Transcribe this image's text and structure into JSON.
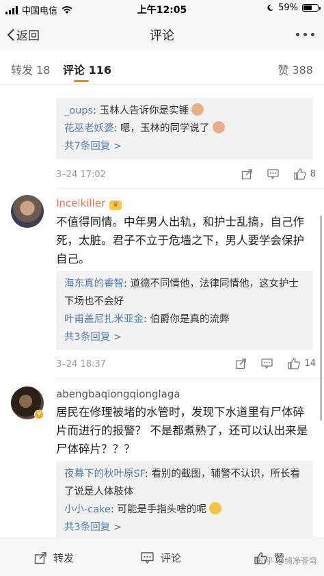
{
  "status_bar": {
    "carrier": "中国电信",
    "time": "上午12:05",
    "battery": "59%",
    "battery_level": 0.59
  },
  "nav": {
    "back_label": "返回",
    "title": "评论"
  },
  "tabs": {
    "repost": "转发 18",
    "comments": "评论 116",
    "likes": "赞 388"
  },
  "comments": [
    {
      "replies": [
        {
          "user": "_oups",
          "text": ": 玉林人告诉你是实锤",
          "emoji": "see-no-evil-monkey-icon"
        },
        {
          "user": "花巫老妖婆",
          "text": ": 嗯，玉林的同学说了",
          "emoji": "see-no-evil-monkey-icon"
        }
      ],
      "more_replies": "共7条回复 >",
      "date": "3–24 17:02",
      "likes": "8"
    },
    {
      "user": "Incelkiller",
      "text": "不值得同情。中年男人出轨，和护士乱搞，自己作死，太脏。君子不立于危墙之下，男人要学会保护自己。",
      "replies": [
        {
          "user": "海东真的睿智",
          "text": ": 道德不同情他，法律同情他，这女护士下场也不会好"
        },
        {
          "user": "叶甫盖尼扎米亚金",
          "text": ": 伯爵你是真的流弊"
        }
      ],
      "more_replies": "共3条回复 >",
      "date": "3–24 18:37",
      "likes": "14"
    },
    {
      "user": "abengbaqiongqionglaga",
      "text": "居民在修理被堵的水管时，发现下水道里有尸体碎片而进行的报警？ 不是都煮熟了，还可以认出来是尸体碎片？？？",
      "replies": [
        {
          "user": "夜幕下的秋叶原SF",
          "text": ": 看别的截图，辅警不认识，所长看了说是人体肢体"
        },
        {
          "user": "小小-cake",
          "text": ": 可能是手指头啥的呢",
          "emoji": "laughing-crying-icon"
        }
      ],
      "more_replies": "共3条回复 >"
    }
  ],
  "bottom_bar": {
    "repost": "转发",
    "comment": "评论",
    "like": "赞",
    "watermark": "知乎 @纯净苍穹"
  },
  "colors": {
    "accent": "#ff8200",
    "link": "#507daf",
    "username_highlight": "#eb7350"
  }
}
